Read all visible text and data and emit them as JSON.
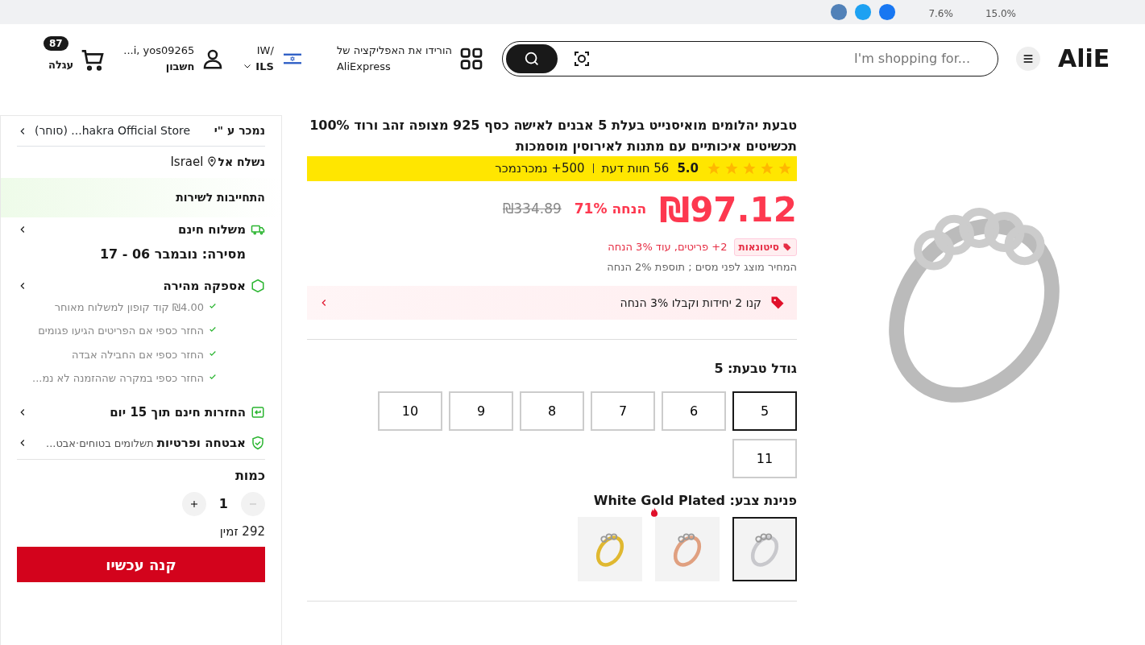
{
  "top_strip": {
    "texts": [
      "15.0%",
      "7.6%"
    ]
  },
  "header": {
    "logo": "AliE",
    "search": {
      "placeholder": "I'm shopping for..."
    },
    "app_promo": {
      "line1": "הורידו את האפליקציה של",
      "line2": "AliExpress"
    },
    "region": {
      "language": "IW/",
      "currency": "ILS"
    },
    "account": {
      "name": "...i, yos09265",
      "label": "חשבון"
    },
    "cart": {
      "count": "87",
      "label": "עגלה"
    }
  },
  "product": {
    "title": "טבעת יהלומים מואיסנייט בעלת 5 אבנים לאישה כסף 925 מצופה זהב ורוד 100% תכשיטים איכותיים עם מתנות לאירוסין מוסמכות",
    "rating": {
      "stars": 5,
      "score": "5.0",
      "reviews": "56 חוות דעת",
      "sold": "500+ נמכרנמכר",
      "highlighted": true
    },
    "price": "₪97.12",
    "discount": "הנחה 71%",
    "old_price": "₪334.89",
    "wholesale": {
      "badge": "סיטונאות",
      "text": "2+ פריטים, עוד 3% הנחה"
    },
    "tax_note": "המחיר מוצג לפני מסים ; תוספת 2% הנחה",
    "promo": "קנו 2 יחידות וקבלו 3% הנחה",
    "size_label": "גודל טבעת: 5",
    "sizes": [
      {
        "label": "5",
        "selected": true
      },
      {
        "label": "6",
        "selected": false
      },
      {
        "label": "7",
        "selected": false
      },
      {
        "label": "8",
        "selected": false
      },
      {
        "label": "9",
        "selected": false
      },
      {
        "label": "10",
        "selected": false
      },
      {
        "label": "11",
        "selected": false
      }
    ],
    "color_label": "פנינת צבע: White Gold Plated",
    "colors": [
      {
        "kind": "silver",
        "selected": true,
        "hot": false
      },
      {
        "kind": "rose",
        "selected": false,
        "hot": true
      },
      {
        "kind": "gold",
        "selected": false,
        "hot": false
      }
    ]
  },
  "sidebar": {
    "seller": {
      "label": "נמכר ע \"י",
      "name": "(סוחר) ...hakra Official Store"
    },
    "ship_to": {
      "label": "נשלח אל",
      "country": "Israel"
    },
    "service_title": "התחייבות לשירות",
    "services": [
      {
        "kind": "shipping",
        "title": "משלוח חינם",
        "detail": "מסירה: נובמבר 06 - 17"
      },
      {
        "kind": "fast",
        "title": "אספקה מהירה",
        "bullets": [
          "₪4.00 קוד קופון למשלוח מאוחר",
          "החזר כספי אם הפריטים הגיעו פגומים",
          "החזר כספי אם החבילה אבדה",
          "החזר כספי במקרה שההזמנה לא נמ..."
        ]
      },
      {
        "kind": "returns",
        "title": "החזרות חינם תוך 15 יום"
      },
      {
        "kind": "security",
        "title": "אבטחה ופרטיות",
        "note": "תשלומים בטוחים·אבט..."
      }
    ],
    "quantity": {
      "label": "כמות",
      "value": "1",
      "available": "292 זמין"
    },
    "buy_button": "קנה עכשיו"
  }
}
